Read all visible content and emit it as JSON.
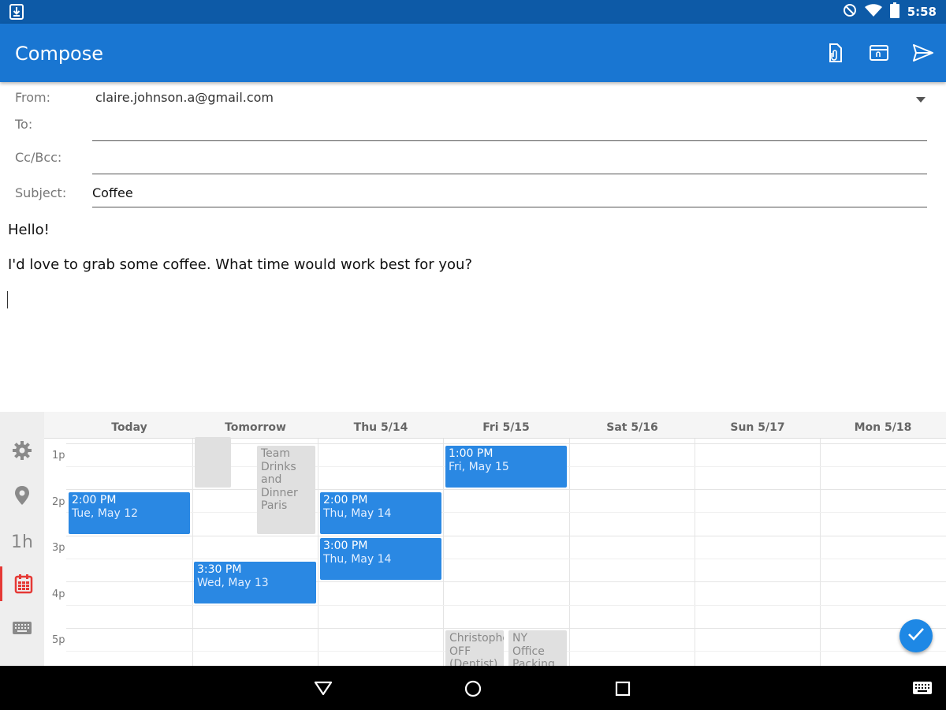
{
  "status_bar": {
    "time": "5:58"
  },
  "app_bar": {
    "title": "Compose"
  },
  "form": {
    "from_label": "From:",
    "from_value": "claire.johnson.a@gmail.com",
    "to_label": "To:",
    "to_value": "",
    "cc_label": "Cc/Bcc:",
    "cc_value": "",
    "subject_label": "Subject:",
    "subject_value": "Coffee"
  },
  "message": {
    "line1": "Hello!",
    "line2": "I'd love to grab some coffee. What time would work best for you?"
  },
  "sidebar": {
    "duration_label": "1h"
  },
  "calendar": {
    "days": [
      "Today",
      "Tomorrow",
      "Thu 5/14",
      "Fri 5/15",
      "Sat 5/16",
      "Sun 5/17",
      "Mon 5/18"
    ],
    "hours": [
      "1p",
      "2p",
      "3p",
      "4p",
      "5p"
    ],
    "proposed_events": [
      {
        "time": "2:00 PM",
        "date": "Tue, May 12"
      },
      {
        "time": "3:30 PM",
        "date": "Wed, May 13"
      },
      {
        "time": "2:00 PM",
        "date": "Thu, May 14"
      },
      {
        "time": "3:00 PM",
        "date": "Thu, May 14"
      },
      {
        "time": "1:00 PM",
        "date": "Fri, May 15"
      }
    ],
    "busy_events": [
      {
        "title": ""
      },
      {
        "title": "Team Drinks and Dinner Paris"
      },
      {
        "title": "Christophe OFF (Dentist)"
      },
      {
        "title": "NY Office Packing"
      }
    ]
  },
  "colors": {
    "status_bar": "#0d5aa7",
    "app_bar": "#1976d2",
    "event": "#2a88e3",
    "busy": "#e0e0e0",
    "active_tab": "#e53935",
    "fab": "#1e88e5"
  },
  "icons": {
    "status_left": "download-icon",
    "status_right": [
      "do-not-disturb-icon",
      "wifi-icon",
      "battery-icon"
    ],
    "app_bar_actions": [
      "attach-file-icon",
      "insert-template-icon",
      "send-icon"
    ],
    "sidebar": [
      "gear-icon",
      "location-pin-icon",
      "duration-1h",
      "calendar-icon",
      "keyboard-icon"
    ],
    "fab": "check-icon",
    "nav": [
      "back-icon",
      "home-icon",
      "recents-icon",
      "keyboard-switch-icon"
    ]
  }
}
